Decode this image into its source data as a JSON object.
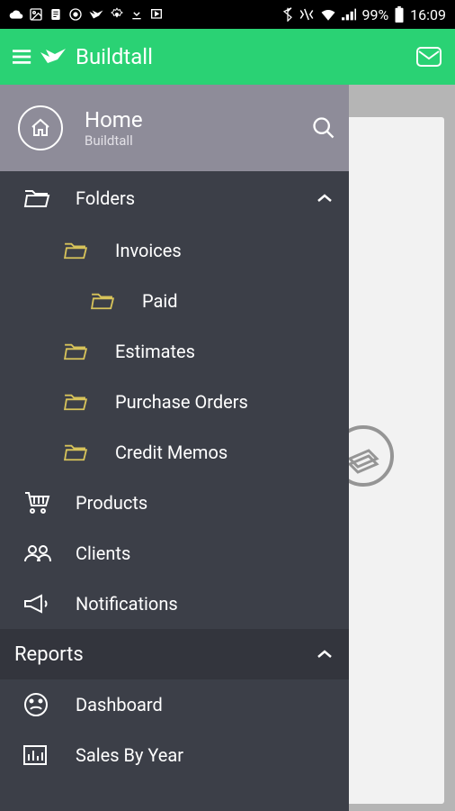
{
  "status": {
    "battery": "99%",
    "time": "16:09"
  },
  "appbar": {
    "title": "Buildtall"
  },
  "drawer": {
    "home_title": "Home",
    "home_sub": "Buildtall",
    "folders_label": "Folders",
    "invoices": "Invoices",
    "paid": "Paid",
    "estimates": "Estimates",
    "purchase_orders": "Purchase Orders",
    "credit_memos": "Credit Memos",
    "products": "Products",
    "clients": "Clients",
    "notifications": "Notifications",
    "reports_label": "Reports",
    "dashboard": "Dashboard",
    "sales_by_year": "Sales By Year"
  }
}
